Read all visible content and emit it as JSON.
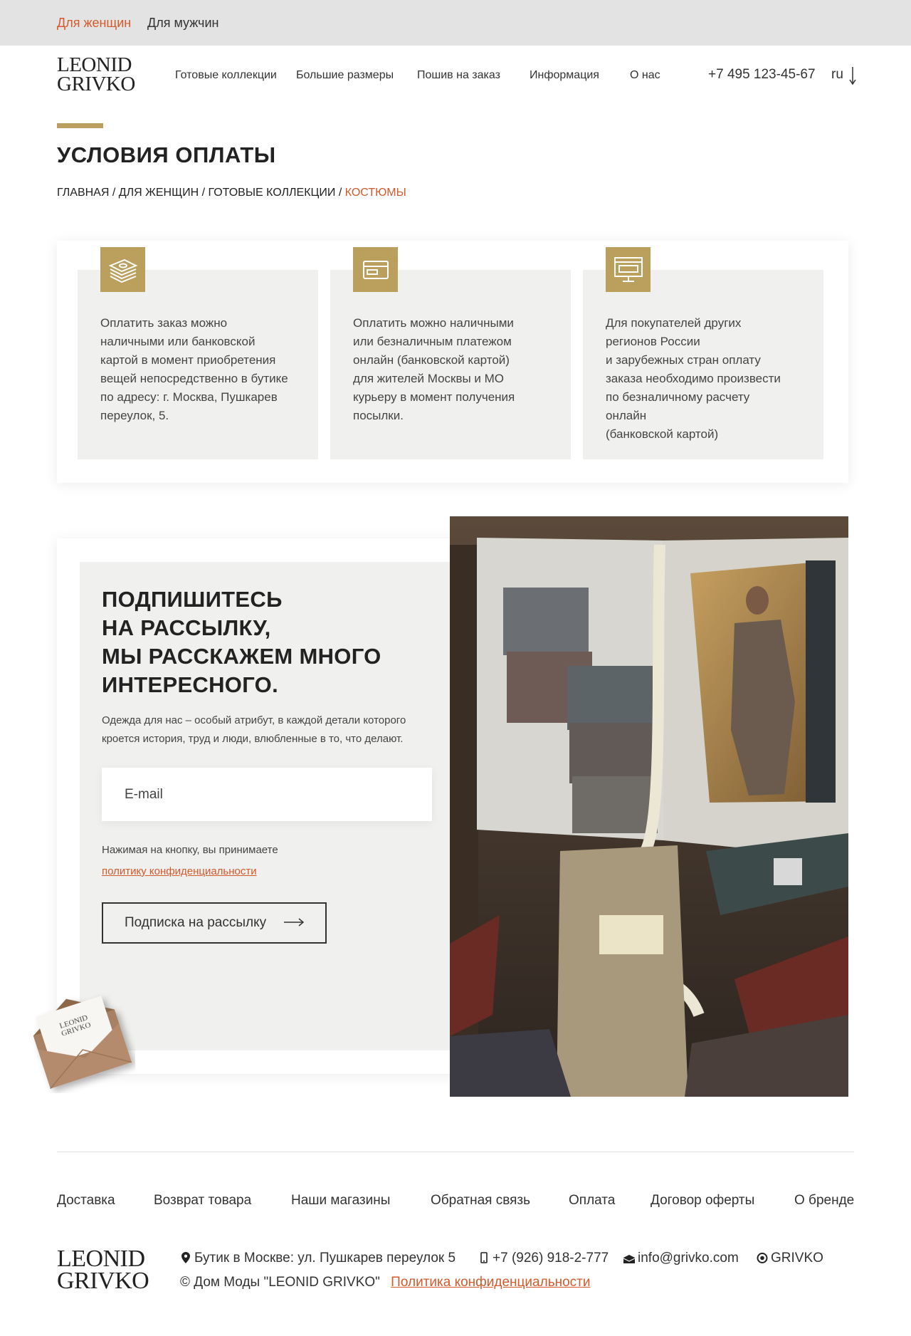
{
  "topbar": {
    "women": "Для женщин",
    "men": "Для мужчин"
  },
  "brand": {
    "line1": "LEONID",
    "line2": "GRIVKO"
  },
  "nav": [
    {
      "label": "Готовые коллекции"
    },
    {
      "label": "Большие размеры"
    },
    {
      "label": "Пошив на заказ"
    },
    {
      "label": "Информация"
    },
    {
      "label": "О нас"
    }
  ],
  "header": {
    "phone": "+7 495 123-45-67",
    "lang": "ru"
  },
  "page": {
    "title": "УСЛОВИЯ ОПЛАТЫ"
  },
  "breadcrumb": {
    "items": [
      "ГЛАВНАЯ",
      "ДЛЯ ЖЕНЩИН",
      "ГОТОВЫЕ КОЛЛЕКЦИИ"
    ],
    "separator": " / ",
    "current": "КОСТЮМЫ"
  },
  "payment": [
    {
      "icon": "cash-stack-icon",
      "text": "Оплатить заказ можно\nналичными или банковской\nкартой в момент приобретения\nвещей непосредственно в бутике\nпо адресу: г. Москва, Пушкарев\nпереулок, 5."
    },
    {
      "icon": "bank-card-icon",
      "text": "Оплатить можно наличными\nили безналичным платежом\nонлайн (банковской картой)\nдля жителей Москвы и МО\nкурьеру в момент получения\nпосылки."
    },
    {
      "icon": "computer-monitor-icon",
      "text": "Для покупателей других\nрегионов России\nи зарубежных стран оплату\nзаказа необходимо произвести\nпо безналичному расчету\nонлайн\n(банковской картой)"
    }
  ],
  "subscribe": {
    "title_lines": [
      "ПОДПИШИТЕСЬ",
      "НА РАССЫЛКУ,",
      "МЫ РАССКАЖЕМ МНОГО",
      "ИНТЕРЕСНОГО."
    ],
    "description": "Одежда для нас – особый атрибут, в каждой детали которого кроется история, труд и люди, влюбленные в то, что делают.",
    "email_placeholder": "E-mail",
    "consent": "Нажимая на кнопку, вы принимаете",
    "consent_link": "политику конфиденциальности",
    "button": "Подписка на рассылку"
  },
  "footer": {
    "links": [
      "Доставка",
      "Возврат товара",
      "Наши магазины",
      "Обратная связь",
      "Оплата",
      "Договор оферты",
      "О бренде"
    ],
    "address": "Бутик в Москве: ул. Пушкарев переулок 5",
    "phone": "+7 (926) 918-2-777",
    "email": "info@grivko.com",
    "social": "GRIVKO",
    "copyright": "© Дом Моды \"LEONID GRIVKO\"",
    "policy": "Политика конфиденциальности"
  },
  "colors": {
    "accent": "#d45a2c",
    "gold": "#bba05d",
    "topbar": "#e3e3e3",
    "card": "#f0f0ef"
  }
}
